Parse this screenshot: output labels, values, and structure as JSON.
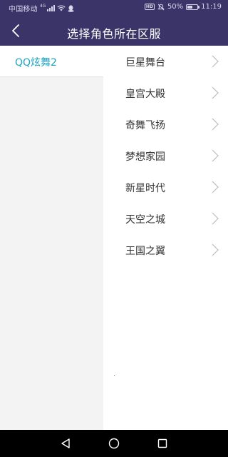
{
  "status_bar": {
    "carrier": "中国移动",
    "signal_tag": "4G",
    "hd_label": "HD",
    "battery_percent": "50%",
    "battery_level": 0.5,
    "time": "11:19"
  },
  "header": {
    "title": "选择角色所在区服",
    "back_icon": "back-arrow-icon"
  },
  "games": [
    {
      "label": "QQ炫舞2",
      "selected": true
    }
  ],
  "servers": [
    {
      "name": "巨星舞台"
    },
    {
      "name": "皇宫大殿"
    },
    {
      "name": "奇舞飞扬"
    },
    {
      "name": "梦想家园"
    },
    {
      "name": "新星时代"
    },
    {
      "name": "天空之城"
    },
    {
      "name": "王国之翼"
    }
  ],
  "nav_bar": {
    "back_icon": "nav-back-triangle-icon",
    "home_icon": "nav-home-circle-icon",
    "recents_icon": "nav-recents-square-icon"
  },
  "colors": {
    "header_bg": "#3b3469",
    "accent": "#1fa3c0",
    "left_panel_bg": "#f3f3f3",
    "text": "#333333",
    "chevron": "#bbbbbb"
  }
}
